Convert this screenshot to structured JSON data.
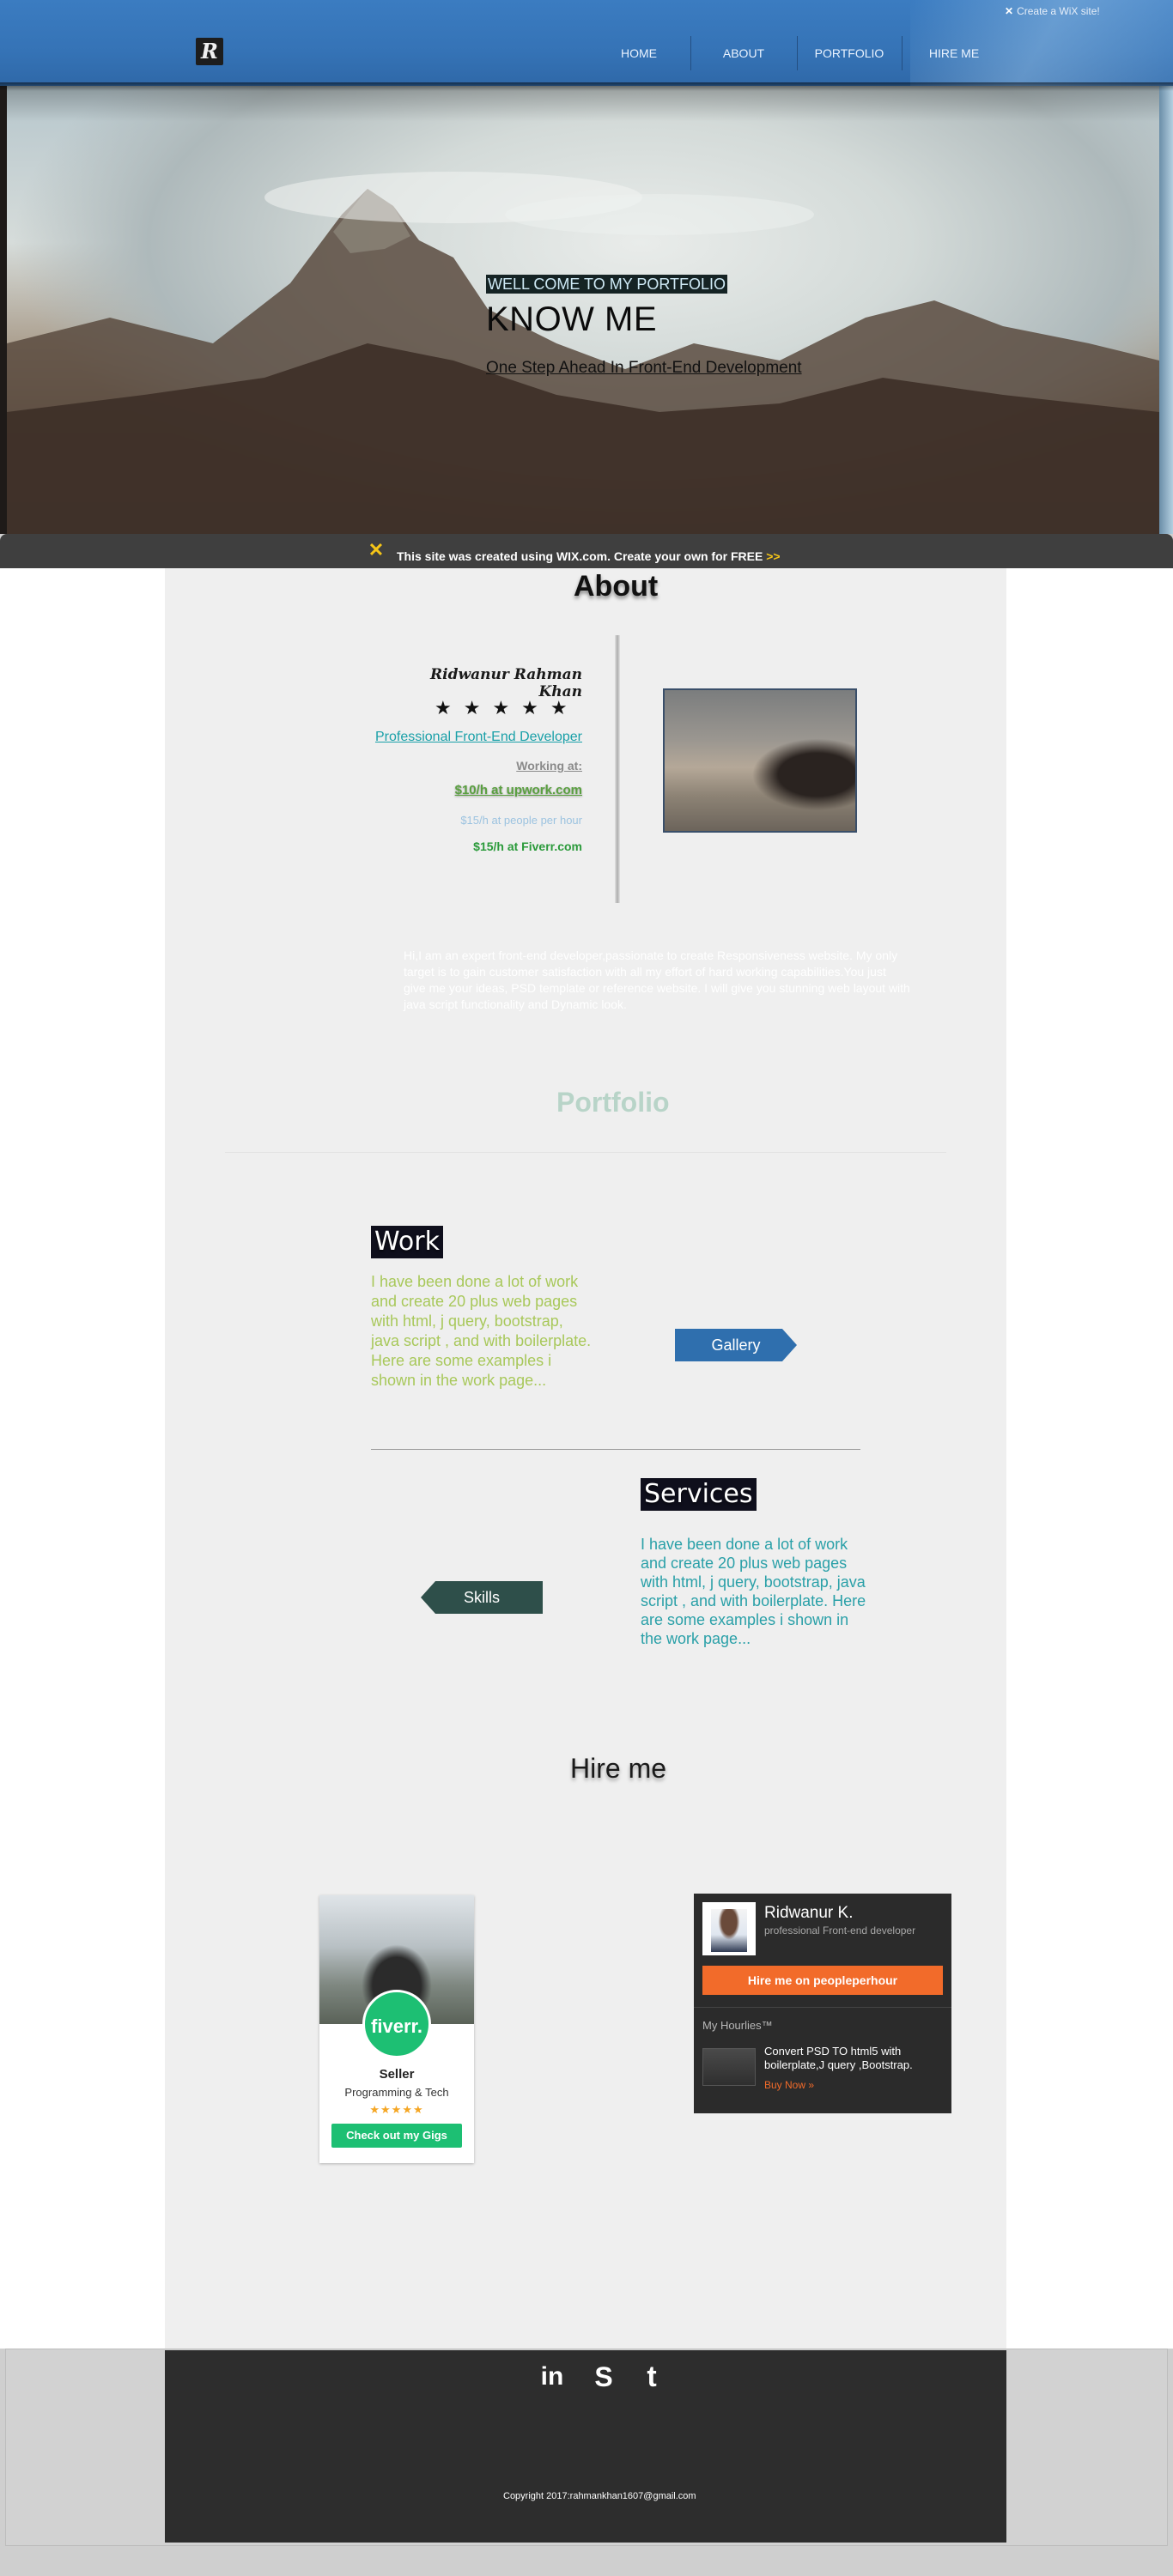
{
  "header": {
    "nav": [
      "HOME",
      "ABOUT",
      "PORTFOLIO",
      "HIRE ME"
    ],
    "wix_link": "Create a WiX site!"
  },
  "hero": {
    "tagline": "WELL COME TO MY PORTFOLIO",
    "title": "KNOW ME",
    "subtitle": "One Step Ahead In Front-End Development"
  },
  "wix_banner": {
    "text": "This site was created using WIX.com. Create your own for FREE",
    "arrow": ">>"
  },
  "about": {
    "title": "About",
    "name": "Ridwanur Rahman Khan",
    "stars": "★★★★★",
    "role": "Professional Front-End Developer",
    "working_at": "Working at:",
    "rate_upwork": "$10/h at upwork.com",
    "rate_pph": "$15/h at people per hour",
    "rate_fiverr": "$15/h at Fiverr.com",
    "text": "Hi,I am an expert front-end developer,passionate to create Responsiveness website. My only target is to gain customer satisfaction with all my effort of hard working capabilities.You just give me your ideas, PSD template or reference website. I will give you stunning web layout with java script functionality and Dynamic look."
  },
  "portfolio": {
    "title": "Portfolio",
    "work_heading": "Work",
    "work_text": "I have been done a lot of work and create 20 plus web pages with html, j query, bootstrap, java script , and with boilerplate. Here are some examples i shown in the work page...",
    "gallery_button": "Gallery",
    "services_heading": "Services",
    "services_text": "I have been done a lot of work and create 20 plus web pages with html, j query, bootstrap, java script , and with boilerplate. Here are some examples i shown in the work page...",
    "skills_button": "Skills"
  },
  "hire": {
    "title": "Hire me",
    "fiverr": {
      "badge": "fiverr.",
      "level": "Seller",
      "category": "Programming & Tech",
      "stars": "★★★★★",
      "button": "Check out my Gigs"
    },
    "pph": {
      "name": "Ridwanur K.",
      "title": "professional Front-end developer",
      "hire_button": "Hire me on peopleperhour",
      "hourlies_label": "My Hourlies™",
      "hourly_title": "Convert PSD TO html5 with boilerplate,J query ,Bootstrap.",
      "buy_now": "Buy Now »"
    }
  },
  "footer": {
    "social": [
      "in",
      "S",
      "t"
    ],
    "copyright": "Copyright 2017:rahmankhan1607@gmail.com"
  },
  "colors": {
    "header_blue": "#3573b6",
    "accent_teal": "#1aa0a8",
    "work_text_green": "#a8c85a",
    "gallery_button_blue": "#2f6fae",
    "skills_button_dark": "#2e4f4a",
    "fiverr_green": "#1dbf73",
    "pph_orange": "#f26b2a",
    "footer_dark": "#2d2d2d"
  },
  "icons": [
    "wix-x-icon",
    "linkedin-icon",
    "skype-icon",
    "tumblr-icon"
  ]
}
